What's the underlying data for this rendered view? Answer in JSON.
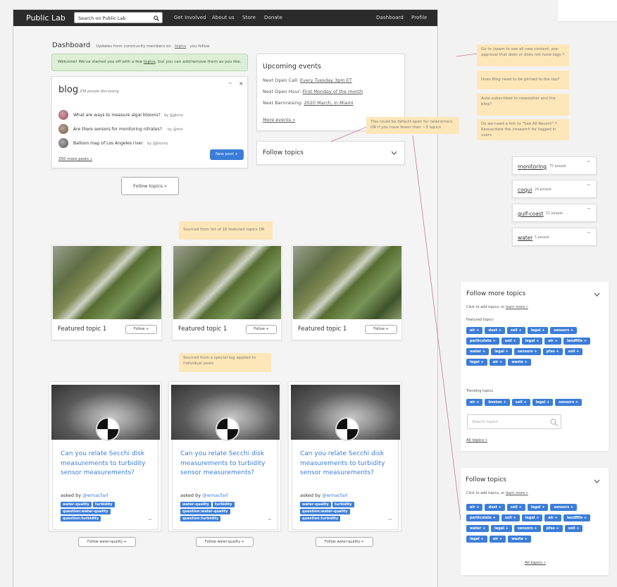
{
  "nav": {
    "logo": "Public Lab",
    "search_placeholder": "Search on Public Lab",
    "links": [
      "Get Involved",
      "About us",
      "Store",
      "Donate"
    ],
    "right_links": [
      "Dashboard",
      "Profile"
    ]
  },
  "header": {
    "title": "Dashboard",
    "subtitle_pre": "Updates from community members on",
    "subtitle_link": "topics",
    "subtitle_post": "you follow"
  },
  "welcome": {
    "pre": "Welcome! We've started you off with a few",
    "link": "topics",
    "post": ", but you can add/remove them as you like."
  },
  "blog": {
    "title": "blog",
    "count": "208 people discussing",
    "posts": [
      {
        "title": "What are ways to measure algal blooms?",
        "author": "by @gloria"
      },
      {
        "title": "Are there sensors for monitoring nitrates?",
        "author": "by @min"
      },
      {
        "title": "Balloon map of Los Angeles river",
        "author": "by @jhonny"
      }
    ],
    "more": "350 more posts »",
    "new_post": "New post +"
  },
  "follow_topics_button": "Follow topics »",
  "events": {
    "title": "Upcoming events",
    "items": [
      {
        "label": "Next Open Call:",
        "value": "Every Tuesday 3pm ET"
      },
      {
        "label": "Next Open Hour:",
        "value": "First Monday of the month"
      },
      {
        "label": "Next Barnraising:",
        "value": "2020 March, in Miami"
      }
    ],
    "more": "More events »"
  },
  "follow_topics_collapsed": "Follow topics",
  "notes": {
    "default_open": "This could be default-open for newcomers OR if you have fewer than ~3 topics",
    "featured_source": "Sourced from list of 18 featured topics OR",
    "special_tag": "Sourced from a special tag applied to individual posts",
    "spam": "Go to /spam to see all  new content, pre-approval that does or does not have tags ?",
    "blog_pinned": "Does Blog need to be pinned to the top?",
    "newsletter": "Auto-subscribed to newsletter and the blog?",
    "see_all_recent": "Do we need a link to \"See All Recent\" ? Resuscitate the /research for logged in users"
  },
  "featured": [
    {
      "title": "Featured topic 1",
      "button": "Follow +"
    },
    {
      "title": "Featured topic 1",
      "button": "Follow +"
    },
    {
      "title": "Featured topic 1",
      "button": "Follow +"
    }
  ],
  "questions": [
    {
      "title": "Can you relate Secchi disk measurements to turbidity sensor measurements?",
      "asked": "asked by",
      "author": "@wmacfarl",
      "tags": [
        "water-quality",
        "turbidity",
        "question:water-quality",
        "question:turbidity"
      ],
      "follow": "Follow water-quality +"
    },
    {
      "title": "Can you relate Secchi disk measurements to turbidity sensor measurements?",
      "asked": "asked by",
      "author": "@wmacfarl",
      "tags": [
        "water-quality",
        "turbidity",
        "question:water-quality",
        "question:turbidity"
      ],
      "follow": "Follow water-quality +"
    },
    {
      "title": "Can you relate Secchi disk measurements to turbidity sensor measurements?",
      "asked": "asked by",
      "author": "@wmacfarl",
      "tags": [
        "water-quality",
        "turbidity",
        "question:water-quality",
        "question:turbidity"
      ],
      "follow": "Follow water-quality +"
    }
  ],
  "topic_chips": [
    {
      "name": "monitoring",
      "count": "75 people"
    },
    {
      "name": "coqui",
      "count": "24 people"
    },
    {
      "name": "gulf-coast",
      "count": "22 people"
    },
    {
      "name": "water",
      "count": "5 people"
    }
  ],
  "follow_more": {
    "title": "Follow more topics",
    "hint_pre": "Click to add topics, or",
    "hint_link": "learn more »",
    "featured_label": "Featured topics",
    "featured_tags": [
      "air +",
      "dust +",
      "soil +",
      "legal +",
      "sensors +",
      "particulate +",
      "soil +",
      "legal +",
      "air +",
      "landfills +",
      "water +",
      "legal +",
      "sensors +",
      "pfas +",
      "soil +",
      "legal +",
      "air +",
      "waste +"
    ],
    "trending_label": "Trending topics",
    "trending_tags": [
      "air +",
      "boston +",
      "soil +",
      "legal +",
      "sensors +"
    ],
    "search_placeholder": "Search topics",
    "all": "All topics »"
  },
  "follow_panel": {
    "title": "Follow topics",
    "hint_pre": "Click to add topics, or",
    "hint_link": "learn more »",
    "tags": [
      "air +",
      "dust +",
      "soil +",
      "legal +",
      "sensors +",
      "particulate +",
      "soil +",
      "legal +",
      "air +",
      "landfills +",
      "water +",
      "legal +",
      "sensors +",
      "pfas +",
      "soil +",
      "legal +",
      "air +",
      "waste +"
    ],
    "all": "All topics »"
  },
  "colors": {
    "accent": "#3b7dd8",
    "note": "#fde7b8",
    "nav": "#2b2b2b",
    "welcome": "#dcefd6"
  }
}
